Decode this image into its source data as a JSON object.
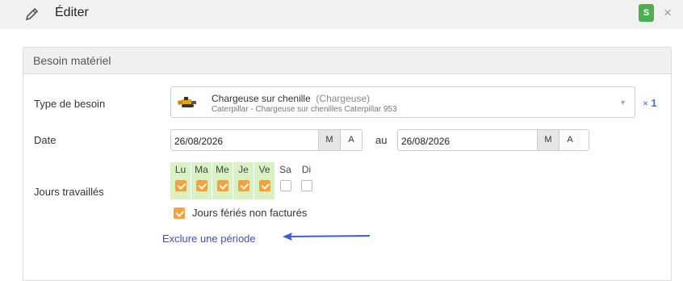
{
  "header": {
    "title": "Éditer",
    "badge": "S",
    "close": "×",
    "pencil_icon": "pencil-icon",
    "close_icon": "close-icon"
  },
  "panel": {
    "title": "Besoin matériel"
  },
  "type_besoin": {
    "label": "Type de besoin",
    "name": "Chargeuse sur chenille",
    "category": "(Chargeuse)",
    "description": "Caterpillar - Chargeuse sur chenilles Caterpillar 953",
    "quantity_prefix": "×",
    "quantity": "1",
    "thumb_icon": "crawler-loader-icon"
  },
  "date": {
    "label": "Date",
    "from": "26/08/2026",
    "to": "26/08/2026",
    "separator": "au",
    "m_label": "M",
    "a_label": "A"
  },
  "jours": {
    "label": "Jours travaillés",
    "days": [
      {
        "name": "Lu",
        "checked": true
      },
      {
        "name": "Ma",
        "checked": true
      },
      {
        "name": "Me",
        "checked": true
      },
      {
        "name": "Je",
        "checked": true
      },
      {
        "name": "Ve",
        "checked": true
      },
      {
        "name": "Sa",
        "checked": false
      },
      {
        "name": "Di",
        "checked": false
      }
    ],
    "holidays_label": "Jours fériés non facturés",
    "holidays_checked": true
  },
  "exclude_link": "Exclure une période",
  "colors": {
    "accent_link": "#3f51b5",
    "badge_green": "#4caf50",
    "checkbox_orange": "#f6a13d",
    "day_on_bg": "#d9f2c4"
  }
}
